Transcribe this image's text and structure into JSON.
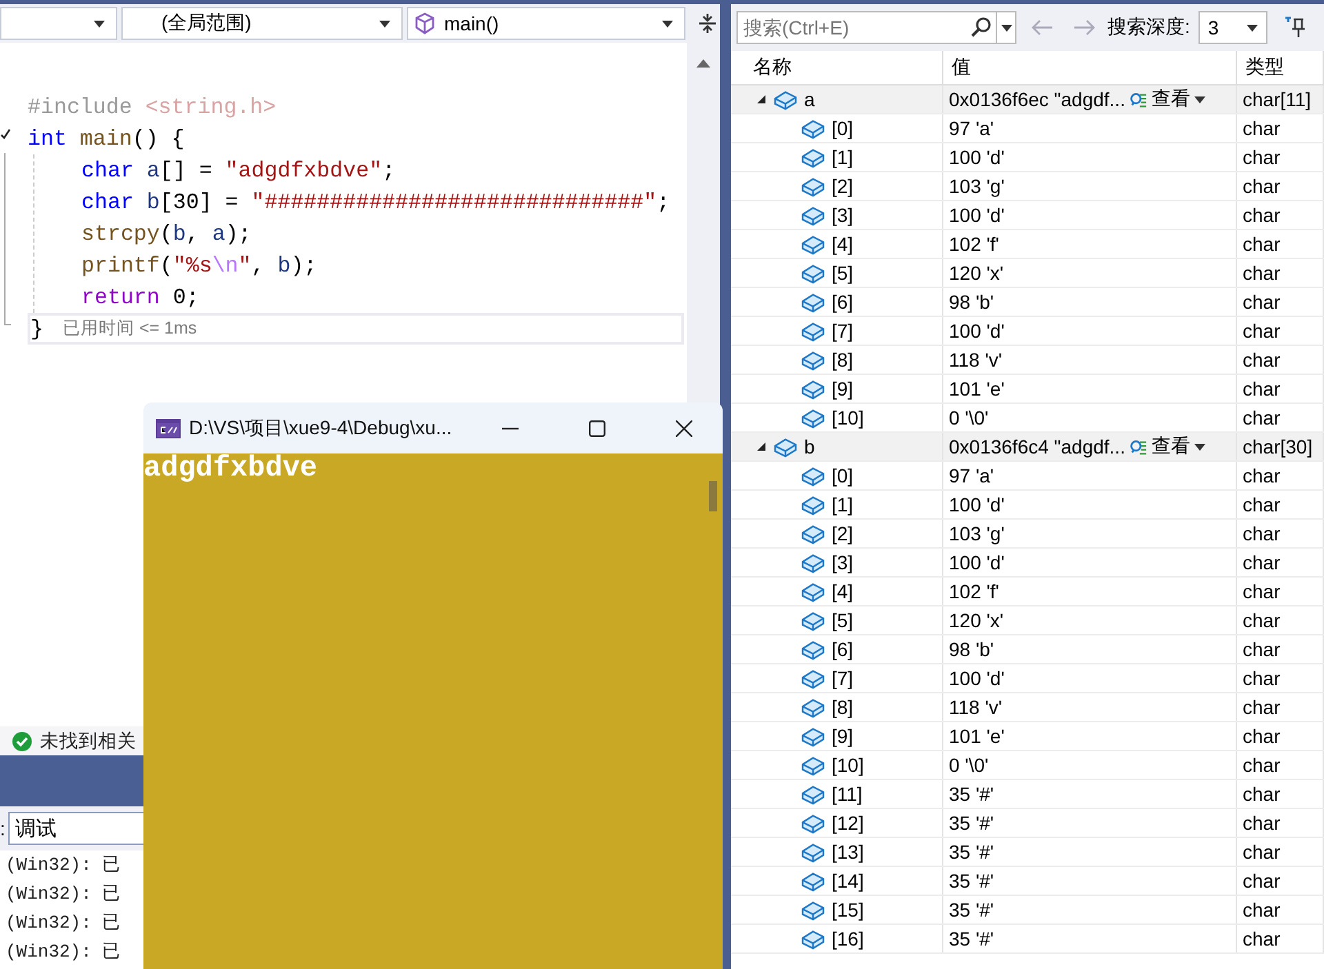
{
  "editor": {
    "navigation_bar": {
      "scope": "(全局范围)",
      "member": "main()"
    },
    "code_lines": [
      {
        "tokens": [
          {
            "text": "#include ",
            "kind": "dim"
          },
          {
            "text": "<string.h>",
            "kind": "dimstr"
          }
        ]
      },
      {
        "tokens": [
          {
            "text": "int",
            "kind": "kw"
          },
          {
            "text": " main",
            "kind": "func"
          },
          {
            "text": "() {",
            "kind": "plain"
          }
        ],
        "children": [
          {
            "tokens": [
              {
                "text": "char",
                "kind": "kw"
              },
              {
                "text": " a",
                "kind": "var"
              },
              {
                "text": "[] = ",
                "kind": "plain"
              },
              {
                "text": "\"adgdfxbdve\"",
                "kind": "str"
              },
              {
                "text": ";",
                "kind": "plain"
              }
            ]
          },
          {
            "tokens": [
              {
                "text": "char",
                "kind": "kw"
              },
              {
                "text": " b",
                "kind": "var"
              },
              {
                "text": "[30] = ",
                "kind": "plain"
              },
              {
                "text": "\"#############################\"",
                "kind": "str"
              },
              {
                "text": ";",
                "kind": "plain"
              }
            ]
          },
          {
            "tokens": [
              {
                "text": "strcpy",
                "kind": "func"
              },
              {
                "text": "(",
                "kind": "plain"
              },
              {
                "text": "b",
                "kind": "var"
              },
              {
                "text": ", ",
                "kind": "plain"
              },
              {
                "text": "a",
                "kind": "var"
              },
              {
                "text": ");",
                "kind": "plain"
              }
            ]
          },
          {
            "tokens": [
              {
                "text": "printf",
                "kind": "func"
              },
              {
                "text": "(",
                "kind": "plain"
              },
              {
                "text": "\"%s",
                "kind": "str"
              },
              {
                "text": "\\n",
                "kind": "esc"
              },
              {
                "text": "\"",
                "kind": "str"
              },
              {
                "text": ", ",
                "kind": "plain"
              },
              {
                "text": "b",
                "kind": "var"
              },
              {
                "text": ");",
                "kind": "plain"
              }
            ]
          },
          {
            "tokens": [
              {
                "text": "return",
                "kind": "ctrl"
              },
              {
                "text": " 0;",
                "kind": "plain"
              }
            ]
          }
        ]
      },
      {
        "tokens": [
          {
            "text": "}",
            "kind": "plain"
          }
        ],
        "perf_tip": "已用时间 <= 1ms"
      }
    ]
  },
  "status_bar": {
    "issues": "未找到相关"
  },
  "output": {
    "source_label": ":",
    "source": "调试",
    "lines": [
      "(Win32): 已",
      "(Win32): 已",
      "(Win32): 已",
      "(Win32): 已"
    ]
  },
  "console": {
    "title": "D:\\VS\\项目\\xue9-4\\Debug\\xu...",
    "output": "adgdfxbdve"
  },
  "watch": {
    "search": {
      "placeholder": "搜索(Ctrl+E)"
    },
    "depth_label": "搜索深度:",
    "depth": "3",
    "columns": [
      "名称",
      "值",
      "类型"
    ],
    "rows": [
      {
        "name": "a",
        "value": "0x0136f6ec \"adgdf...",
        "view": "查看",
        "type": "char[11]",
        "expanded": true,
        "children": [
          {
            "name": "[0]",
            "value": "97 'a'",
            "type": "char"
          },
          {
            "name": "[1]",
            "value": "100 'd'",
            "type": "char"
          },
          {
            "name": "[2]",
            "value": "103 'g'",
            "type": "char"
          },
          {
            "name": "[3]",
            "value": "100 'd'",
            "type": "char"
          },
          {
            "name": "[4]",
            "value": "102 'f'",
            "type": "char"
          },
          {
            "name": "[5]",
            "value": "120 'x'",
            "type": "char"
          },
          {
            "name": "[6]",
            "value": "98 'b'",
            "type": "char"
          },
          {
            "name": "[7]",
            "value": "100 'd'",
            "type": "char"
          },
          {
            "name": "[8]",
            "value": "118 'v'",
            "type": "char"
          },
          {
            "name": "[9]",
            "value": "101 'e'",
            "type": "char"
          },
          {
            "name": "[10]",
            "value": "0 '\\0'",
            "type": "char"
          }
        ]
      },
      {
        "name": "b",
        "value": "0x0136f6c4 \"adgdf...",
        "view": "查看",
        "type": "char[30]",
        "expanded": true,
        "children": [
          {
            "name": "[0]",
            "value": "97 'a'",
            "type": "char"
          },
          {
            "name": "[1]",
            "value": "100 'd'",
            "type": "char"
          },
          {
            "name": "[2]",
            "value": "103 'g'",
            "type": "char"
          },
          {
            "name": "[3]",
            "value": "100 'd'",
            "type": "char"
          },
          {
            "name": "[4]",
            "value": "102 'f'",
            "type": "char"
          },
          {
            "name": "[5]",
            "value": "120 'x'",
            "type": "char"
          },
          {
            "name": "[6]",
            "value": "98 'b'",
            "type": "char"
          },
          {
            "name": "[7]",
            "value": "100 'd'",
            "type": "char"
          },
          {
            "name": "[8]",
            "value": "118 'v'",
            "type": "char"
          },
          {
            "name": "[9]",
            "value": "101 'e'",
            "type": "char"
          },
          {
            "name": "[10]",
            "value": "0 '\\0'",
            "type": "char"
          },
          {
            "name": "[11]",
            "value": "35 '#'",
            "type": "char"
          },
          {
            "name": "[12]",
            "value": "35 '#'",
            "type": "char"
          },
          {
            "name": "[13]",
            "value": "35 '#'",
            "type": "char"
          },
          {
            "name": "[14]",
            "value": "35 '#'",
            "type": "char"
          },
          {
            "name": "[15]",
            "value": "35 '#'",
            "type": "char"
          },
          {
            "name": "[16]",
            "value": "35 '#'",
            "type": "char"
          }
        ]
      }
    ]
  }
}
